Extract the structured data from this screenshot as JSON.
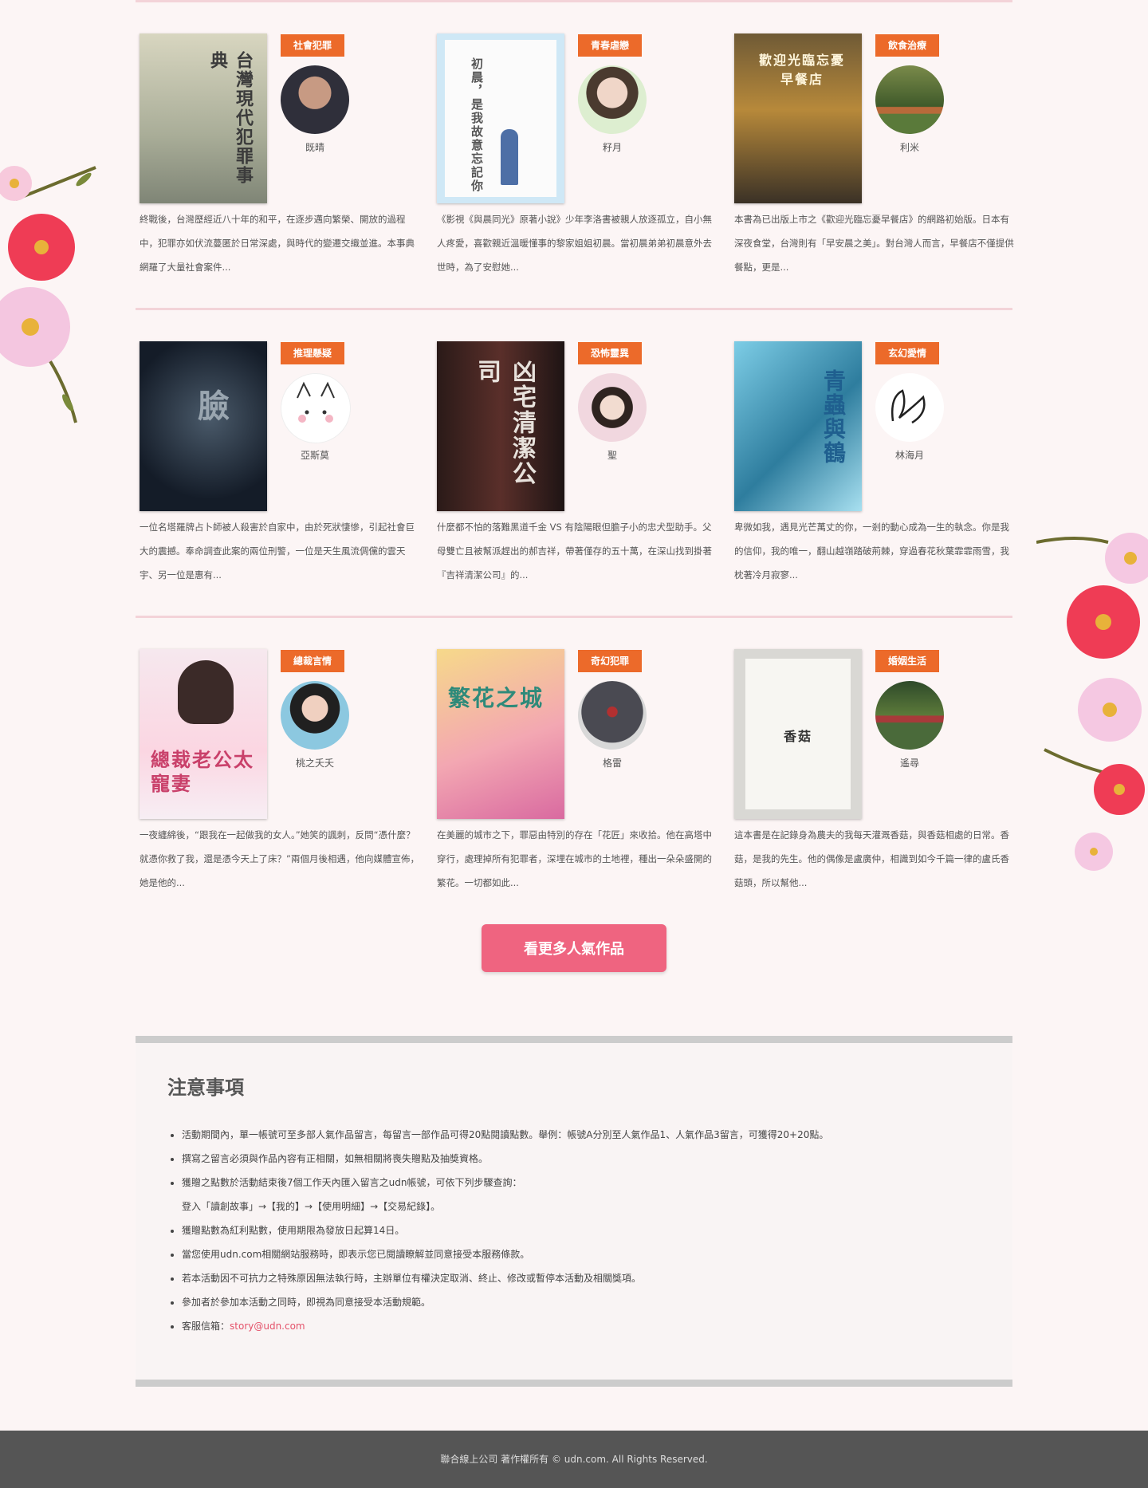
{
  "books": [
    {
      "category": "社會犯罪",
      "author": "既晴",
      "cover_title": "台灣現代犯罪事典",
      "desc": "終戰後，台灣歷經近八十年的和平，在逐步邁向繁榮、開放的過程中，犯罪亦如伏流蔓匿於日常深處，與時代的變遷交織並進。本事典網羅了大量社會案件..."
    },
    {
      "category": "青春虐戀",
      "author": "籽月",
      "cover_title": "初晨，是我故意忘記你",
      "desc": "《影視《與晨同光》原著小說》少年李洛書被親人放逐孤立，自小無人疼愛，喜歡親近溫暖懂事的黎家姐姐初晨。當初晨弟弟初晨意外去世時，為了安慰她..."
    },
    {
      "category": "飲食治療",
      "author": "利米",
      "cover_title": "歡迎光臨忘憂早餐店",
      "desc": "本書為已出版上市之《歡迎光臨忘憂早餐店》的網路初始版。日本有深夜食堂，台灣則有「早安晨之美」。對台灣人而言，早餐店不僅提供餐點，更是..."
    },
    {
      "category": "推理懸疑",
      "author": "亞斯莫",
      "cover_title": "臉",
      "desc": "一位名塔羅牌占卜師被人殺害於自家中，由於死狀悽慘，引起社會巨大的震撼。奉命調查此案的兩位刑警，一位是天生風流倜儻的雲天宇、另一位是惠有..."
    },
    {
      "category": "恐怖靈異",
      "author": "聖",
      "cover_title": "凶宅清潔公司",
      "desc": "什麼都不怕的落難黑道千金 VS 有陰陽眼但膽子小的忠犬型助手。父母雙亡且被幫派趕出的郝吉祥，帶著僅存的五十萬，在深山找到掛著『吉祥清潔公司』的..."
    },
    {
      "category": "玄幻愛情",
      "author": "林海月",
      "cover_title": "青蟲與鶴",
      "desc": "卑微如我，遇見光芒萬丈的你，一剎的動心成為一生的執念。你是我的信仰，我的唯一，翻山越嶺踏破荊棘，穿過春花秋葉霏霏雨雪，我枕著冷月寂寥..."
    },
    {
      "category": "總裁言情",
      "author": "桃之夭夭",
      "cover_title": "總裁老公太寵妻",
      "desc": "一夜纏綿後，“跟我在一起做我的女人。”她笑的諷刺，反問“憑什麼？就憑你救了我，還是憑今天上了床？”兩個月後相遇，他向媒體宣佈，她是他的..."
    },
    {
      "category": "奇幻犯罪",
      "author": "格雷",
      "cover_title": "繁花之城",
      "desc": "在美麗的城市之下，罪惡由特別的存在「花匠」來收拾。他在高塔中穿行，處理掉所有犯罪者，深埋在城市的土地裡，種出一朵朵盛開的繁花。一切都如此..."
    },
    {
      "category": "婚姻生活",
      "author": "遙尋",
      "cover_title": "香菇",
      "desc": "這本書是在記錄身為農夫的我每天灌溉香菇，與香菇相處的日常。香菇，是我的先生。他的偶像是盧廣仲，相識到如今千篇一律的盧氏香菇頭，所以幫他..."
    }
  ],
  "more_button": "看更多人氣作品",
  "notice": {
    "title": "注意事項",
    "items": [
      "活動期間內，單一帳號可至多部人氣作品留言，每留言一部作品可得20點閱讀點數。舉例：帳號A分別至人氣作品1、人氣作品3留言，可獲得20+20點。",
      "撰寫之留言必須與作品內容有正相關，如無相關將喪失贈點及抽獎資格。",
      "獲贈之點數於活動結束後7個工作天內匯入留言之udn帳號，可依下列步驟查詢：",
      "登入「讀創故事」→【我的】→【使用明細】→【交易紀錄】。",
      "獲贈點數為紅利點數，使用期限為發放日起算14日。",
      "當您使用udn.com相關網站服務時，即表示您已閱讀瞭解並同意接受本服務條款。",
      "若本活動因不可抗力之特殊原因無法執行時，主辦單位有權決定取消、終止、修改或暫停本活動及相關獎項。",
      "參加者於參加本活動之同時，即視為同意接受本活動規範。"
    ],
    "contact_label": "客服信箱：",
    "contact_email": "story@udn.com"
  },
  "footer": "聯合線上公司 著作權所有 © udn.com. All Rights Reserved.",
  "colors": {
    "accent": "#ec6a2a",
    "button": "#ef6480",
    "link": "#e4526a",
    "rule": "#f3d3d8",
    "footer_bg": "#555555"
  }
}
